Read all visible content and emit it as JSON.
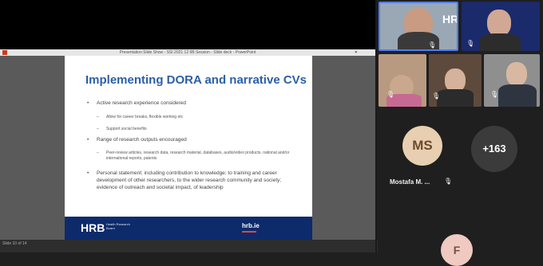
{
  "window": {
    "title": "Presentation Slide Show - SSI 2021 12 6B Session - Slide deck - PowerPoint",
    "close_glyph": "✕",
    "status_text": "Slide 10 of 14"
  },
  "slide": {
    "title": "Implementing DORA and narrative CVs",
    "bullets": [
      {
        "text": "Active research experience considered"
      },
      {
        "text": "Range of research outputs encouraged"
      },
      {
        "text": "Personal statement: including contribution to knowledge; to training and career development of other researchers, to the wider research community and society; evidence of outreach and societal impact, of leadership"
      }
    ],
    "subs": [
      {
        "text": "Allow for career breaks, flexible working etc"
      },
      {
        "text": "Support social benefits"
      },
      {
        "text": "Peer-review articles, research data, research material, databases, audio/video products, national and/or international reports, patents"
      }
    ],
    "bullet_glyph": "•",
    "sub_glyph": "–",
    "footer": {
      "logo_mark": "HRB",
      "logo_text": "Health Research Board",
      "url": "hrb.ie"
    }
  },
  "participants": {
    "ms_initials": "MS",
    "ms_name": "Mostafa M. ...",
    "more_count": "+163",
    "bottom_initial": "F"
  },
  "icons": {
    "mic_muted": "🎙"
  },
  "colors": {
    "ms_avatar": "#e8cfb1",
    "ms_text": "#6b4a2a",
    "more_avatar": "#3b3b3b",
    "bottom_avatar": "#f0c9c0",
    "slide_title": "#2b5fa8",
    "footer_bg": "#0d2a6b"
  }
}
